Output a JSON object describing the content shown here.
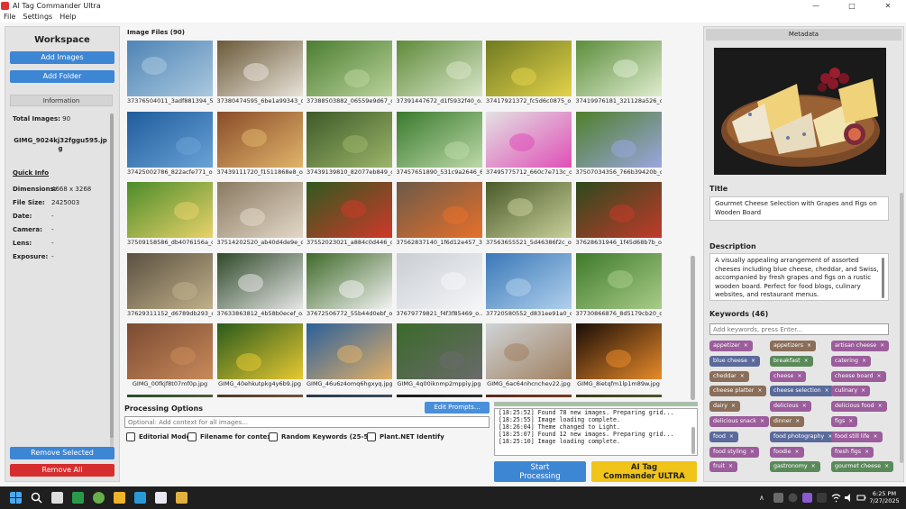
{
  "window": {
    "title": "AI Tag Commander Ultra",
    "minimize": "—",
    "maximize": "□",
    "close": "✕"
  },
  "menu": [
    "File",
    "Settings",
    "Help"
  ],
  "left": {
    "title": "Workspace",
    "add_images": "Add Images",
    "add_folder": "Add Folder",
    "info_header": "Information",
    "total_label": "Total Images:",
    "total_value": "90",
    "filename_line1": "GIMG_9024kj32fggu595.jp",
    "filename_line2": "g",
    "quick_info": "Quick Info",
    "fields": [
      {
        "k": "Dimensions:",
        "v": "4668 x 3268"
      },
      {
        "k": "File Size:",
        "v": "2425003"
      },
      {
        "k": "Date:",
        "v": "-"
      },
      {
        "k": "Camera:",
        "v": "-"
      },
      {
        "k": "Lens:",
        "v": "-"
      },
      {
        "k": "Exposure:",
        "v": "-"
      }
    ],
    "remove_selected": "Remove Selected",
    "remove_all": "Remove All"
  },
  "center": {
    "files_label": "Image Files (90)",
    "images": [
      {
        "cap": "37376504011_3adf881394_5k...",
        "c1": "#4f84b5",
        "c2": "#a9c8de"
      },
      {
        "cap": "37380474595_6be1a99343_o...",
        "c1": "#6b5a3a",
        "c2": "#e8e2d8"
      },
      {
        "cap": "37388503882_06559e9d67_o...",
        "c1": "#4c7d31",
        "c2": "#b9d39a"
      },
      {
        "cap": "37391447672_d1f5932f40_o...",
        "c1": "#5f8a3a",
        "c2": "#d8e6c8"
      },
      {
        "cap": "37417921372_fc5d6c0875_o...",
        "c1": "#6f7a22",
        "c2": "#e2d24a"
      },
      {
        "cap": "37419976181_321128a526_o...",
        "c1": "#5c8e3c",
        "c2": "#dfeccf"
      },
      {
        "cap": "37425002786_822acfe771_o...",
        "c1": "#1f5c9c",
        "c2": "#6aa2d6"
      },
      {
        "cap": "37439111720_f1511868e8_o...",
        "c1": "#8a4c2a",
        "c2": "#e0b46a"
      },
      {
        "cap": "37439139810_82077eb849_o...",
        "c1": "#3e5a28",
        "c2": "#9bb56a"
      },
      {
        "cap": "37457651890_531c9a2646_6k...",
        "c1": "#3a7a2e",
        "c2": "#bcd9a8"
      },
      {
        "cap": "37495775712_660c7e713c_o...",
        "c1": "#e2e2e2",
        "c2": "#e04fb8"
      },
      {
        "cap": "37507034356_766b39420b_o...",
        "c1": "#4f7f2a",
        "c2": "#9aa6e0"
      },
      {
        "cap": "37509158586_db4076156a_o...",
        "c1": "#4c8c2a",
        "c2": "#e8d26a"
      },
      {
        "cap": "37514202520_ab40d4de9e_o...",
        "c1": "#8a7a62",
        "c2": "#e3d8c8"
      },
      {
        "cap": "37552023021_a884c0d446_o...",
        "c1": "#2f5a1f",
        "c2": "#d0382a"
      },
      {
        "cap": "37562837140_1f6d12e457_3k...",
        "c1": "#6a5a4a",
        "c2": "#e7702a"
      },
      {
        "cap": "37563655521_5d46386f2c_o...",
        "c1": "#4a5a2a",
        "c2": "#c8d09a"
      },
      {
        "cap": "37628631946_1f45d68b7b_o...",
        "c1": "#2c4a1e",
        "c2": "#c23a2a"
      },
      {
        "cap": "37629311152_d6789db293_o...",
        "c1": "#5a5040",
        "c2": "#c0b08a"
      },
      {
        "cap": "37633863812_4b58b0ecef_o...",
        "c1": "#2f4a2a",
        "c2": "#e6e6e6"
      },
      {
        "cap": "37672506772_55b44d0ebf_o...",
        "c1": "#3f6a2a",
        "c2": "#f2f2f2"
      },
      {
        "cap": "37679779821_f4f3f85469_o...",
        "c1": "#c9ced3",
        "c2": "#f5f6f8"
      },
      {
        "cap": "37720580552_d831ee91a0_o...",
        "c1": "#3a78b8",
        "c2": "#b0d0ec"
      },
      {
        "cap": "37730866876_8d5179cb20_o...",
        "c1": "#3f7a2a",
        "c2": "#a8cc88"
      },
      {
        "cap": "GIMG_00fkjf8t07mf0p.jpg",
        "c1": "#7a4a32",
        "c2": "#c88a5a"
      },
      {
        "cap": "GIMG_40ehkutpkg4y6b9.jpg",
        "c1": "#2a5a1c",
        "c2": "#e6c832"
      },
      {
        "cap": "GIMG_46u6z4omq6hgxyq.jpg",
        "c1": "#2a5f9a",
        "c2": "#e2b068"
      },
      {
        "cap": "GIMG_4q00iknmp2mppiy.jpg",
        "c1": "#3a6a2a",
        "c2": "#6a6a6a"
      },
      {
        "cap": "GIMG_6ac64nhcnchev22.jpg",
        "c1": "#cfd3d6",
        "c2": "#a08060"
      },
      {
        "cap": "GIMG_8ietqfm1lp1m89w.jpg",
        "c1": "#1a0d08",
        "c2": "#e88a2a"
      },
      {
        "cap": "",
        "c1": "#2a4a2a",
        "c2": "#6a6a4a"
      },
      {
        "cap": "",
        "c1": "#4a3a2a",
        "c2": "#8a6a4a"
      },
      {
        "cap": "",
        "c1": "#2a3a4a",
        "c2": "#4a5a6a"
      },
      {
        "cap": "",
        "c1": "#1a1a1a",
        "c2": "#3a3a3a"
      },
      {
        "cap": "",
        "c1": "#5a2a1a",
        "c2": "#8a4a2a"
      },
      {
        "cap": "",
        "c1": "#3a3a1a",
        "c2": "#6a6a3a"
      }
    ],
    "processing_title": "Processing Options",
    "edit_prompts": "Edit Prompts...",
    "context_placeholder": "Optional: Add context for all images...",
    "checks": [
      "Editorial Mode",
      "Filename for context",
      "Random Keywords (25-50)",
      "Plant.NET Identify"
    ],
    "log": [
      "[18:25:52] Found 78 new images. Preparing grid...",
      "[18:25:55] Image loading complete.",
      "[18:26:04] Theme changed to Light.",
      "[18:25:07] Found 12 new images. Preparing grid...",
      "[18:25:10] Image loading complete."
    ],
    "start_line1": "Start",
    "start_line2": "Processing",
    "ultra_line1": "AI Tag",
    "ultra_line2": "Commander ULTRA"
  },
  "right": {
    "header": "Metadata",
    "title_label": "Title",
    "title_value": "Gourmet Cheese Selection with Grapes and Figs on Wooden Board",
    "desc_label": "Description",
    "desc_value": "A visually appealing arrangement of assorted cheeses including blue cheese, cheddar, and Swiss, accompanied by fresh grapes and figs on a rustic wooden board. Perfect for food blogs, culinary websites, and restaurant menus.",
    "keywords_label": "Keywords (46)",
    "keyword_placeholder": "Add keywords, press Enter...",
    "tags": [
      {
        "t": "appetizer",
        "c": "#9b5d9b"
      },
      {
        "t": "appetizers",
        "c": "#8a6e5a"
      },
      {
        "t": "artisan cheese",
        "c": "#9b5d9b"
      },
      {
        "t": "blue cheese",
        "c": "#5a6a9b"
      },
      {
        "t": "breakfast",
        "c": "#5a8a5a"
      },
      {
        "t": "catering",
        "c": "#9b5d9b"
      },
      {
        "t": "cheddar",
        "c": "#8a6e5a"
      },
      {
        "t": "cheese",
        "c": "#9b5d9b"
      },
      {
        "t": "cheese board",
        "c": "#9b5d9b"
      },
      {
        "t": "cheese platter",
        "c": "#8a6e5a"
      },
      {
        "t": "cheese selection",
        "c": "#5a6a9b"
      },
      {
        "t": "culinary",
        "c": "#9b5d9b"
      },
      {
        "t": "dairy",
        "c": "#8a6e5a"
      },
      {
        "t": "delicious",
        "c": "#9b5d9b"
      },
      {
        "t": "delicious food",
        "c": "#9b5d9b"
      },
      {
        "t": "delicious snack",
        "c": "#9b5d9b"
      },
      {
        "t": "dinner",
        "c": "#8a6e5a"
      },
      {
        "t": "figs",
        "c": "#9b5d9b"
      },
      {
        "t": "food",
        "c": "#5a6a9b"
      },
      {
        "t": "food photography",
        "c": "#5a6a9b"
      },
      {
        "t": "food still life",
        "c": "#9b5d9b"
      },
      {
        "t": "food styling",
        "c": "#9b5d9b"
      },
      {
        "t": "foodie",
        "c": "#9b5d9b"
      },
      {
        "t": "fresh figs",
        "c": "#9b5d9b"
      },
      {
        "t": "fruit",
        "c": "#9b5d9b"
      },
      {
        "t": "gastronomy",
        "c": "#5a8a5a"
      },
      {
        "t": "gourmet cheese",
        "c": "#5a8a5a"
      }
    ]
  },
  "taskbar": {
    "time": "6:25 PM",
    "date": "7/27/2025",
    "tray_chevron": "∧"
  }
}
